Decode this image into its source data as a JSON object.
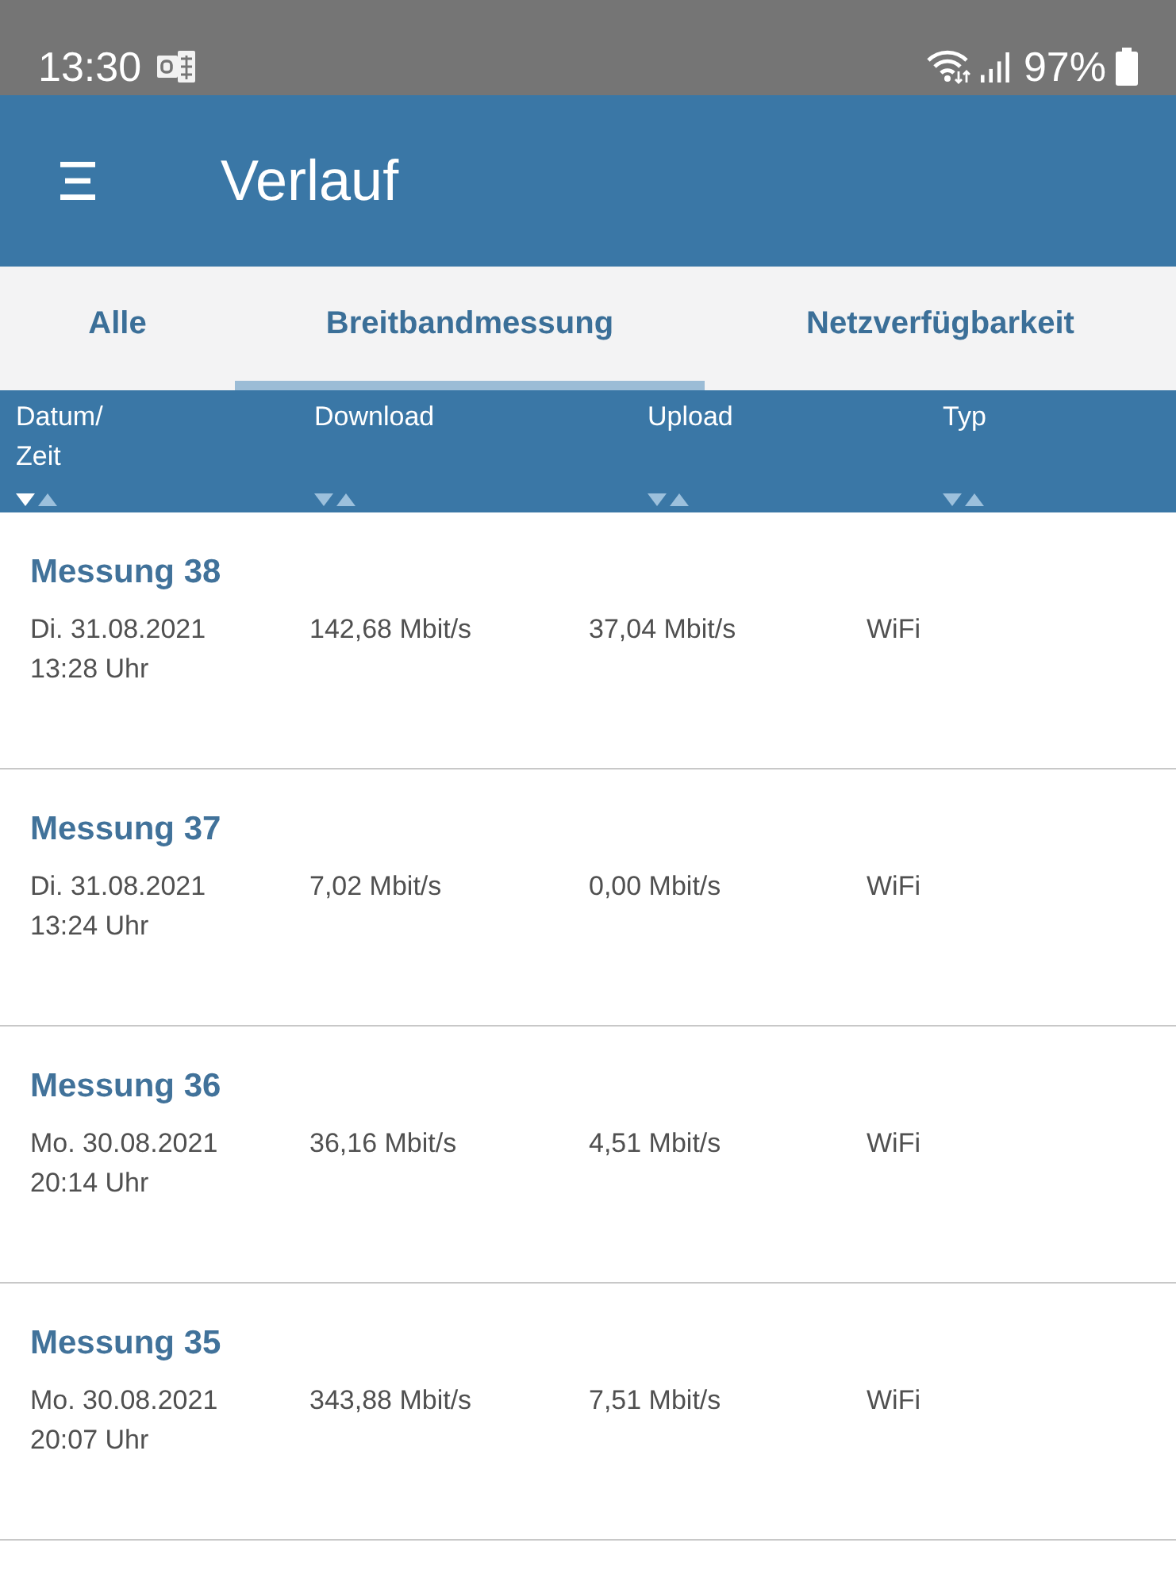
{
  "status_bar": {
    "time": "13:30",
    "battery": "97%"
  },
  "app_bar": {
    "title": "Verlauf"
  },
  "tabs": [
    {
      "label": "Alle",
      "selected": false
    },
    {
      "label": "Breitbandmessung",
      "selected": true
    },
    {
      "label": "Netzverfügbarkeit",
      "selected": false
    }
  ],
  "table": {
    "columns": [
      {
        "lines": [
          "Datum/",
          "Zeit"
        ],
        "sorted_descending": true
      },
      {
        "lines": [
          "Download"
        ],
        "sorted_descending": false
      },
      {
        "lines": [
          "Upload"
        ],
        "sorted_descending": false
      },
      {
        "lines": [
          "Typ"
        ],
        "sorted_descending": false
      }
    ],
    "rows": [
      {
        "title": "Messung 38",
        "date": "Di. 31.08.2021",
        "time": "13:28 Uhr",
        "download": "142,68 Mbit/s",
        "upload": "37,04 Mbit/s",
        "type": "WiFi"
      },
      {
        "title": "Messung 37",
        "date": "Di. 31.08.2021",
        "time": "13:24 Uhr",
        "download": "7,02 Mbit/s",
        "upload": "0,00 Mbit/s",
        "type": "WiFi"
      },
      {
        "title": "Messung 36",
        "date": "Mo. 30.08.2021",
        "time": "20:14 Uhr",
        "download": "36,16 Mbit/s",
        "upload": "4,51 Mbit/s",
        "type": "WiFi"
      },
      {
        "title": "Messung 35",
        "date": "Mo. 30.08.2021",
        "time": "20:07 Uhr",
        "download": "343,88 Mbit/s",
        "upload": "7,51 Mbit/s",
        "type": "WiFi"
      }
    ]
  }
}
